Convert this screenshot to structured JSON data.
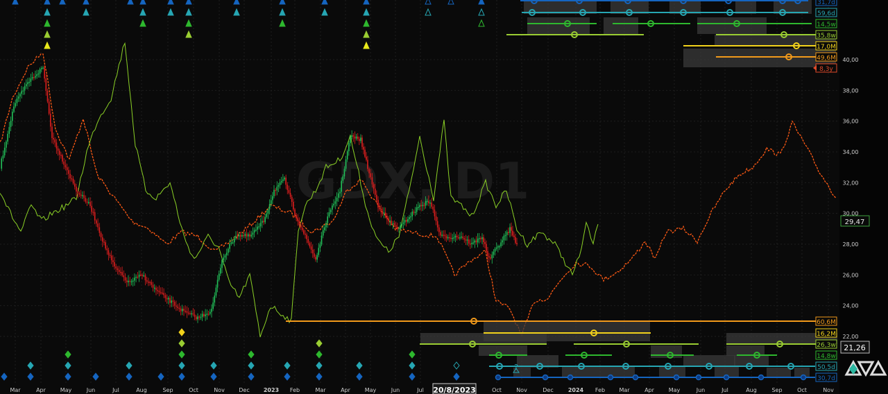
{
  "chart_data": {
    "type": "line",
    "title": "GDX, D1",
    "series": [
      {
        "name": "GDX",
        "kind": "candles"
      },
      {
        "name": "",
        "kind": "green-line"
      },
      {
        "name": "",
        "kind": "orange-dashed"
      }
    ],
    "ylim": [
      20.0,
      42.0
    ],
    "yticks": [
      "40,00",
      "38,00",
      "36,00",
      "34,00",
      "32,00",
      "30,00",
      "28,00",
      "26,00",
      "24,00",
      "22,00"
    ],
    "xticks": [
      "Mar",
      "Apr",
      "May",
      "Jun",
      "Jul",
      "Aug",
      "Sep",
      "Oct",
      "Nov",
      "Dec",
      "2023",
      "Feb",
      "Mar",
      "Apr",
      "May",
      "Jun",
      "Jul",
      "20/8/2023",
      "Oct",
      "Nov",
      "Dec",
      "2024",
      "Feb",
      "Mar",
      "Apr",
      "May",
      "Jun",
      "Jul",
      "Aug",
      "Sep",
      "Oct",
      "Nov"
    ],
    "cursor_date": "20/8/2023",
    "last_price": "29,47",
    "crosshair_price": "21,26",
    "top_cycles": [
      {
        "label": "31,7d",
        "color": "#1565c0"
      },
      {
        "label": "59,6d",
        "color": "#26a6b3"
      },
      {
        "label": "14,5w",
        "color": "#2eb82e"
      },
      {
        "label": "35,8w",
        "color": "#9acd32"
      },
      {
        "label": "17,0M",
        "color": "#f2d21b"
      },
      {
        "label": "49,6M",
        "color": "#f29a1b"
      },
      {
        "label": "8,3y",
        "color": "#e04a2a"
      }
    ],
    "bottom_cycles": [
      {
        "label": "60,6M",
        "color": "#f29a1b"
      },
      {
        "label": "16,2M",
        "color": "#f2d21b"
      },
      {
        "label": "26,3w",
        "color": "#9acd32"
      },
      {
        "label": "14,8w",
        "color": "#2eb82e"
      },
      {
        "label": "50,5d",
        "color": "#26a6b3"
      },
      {
        "label": "30,7d",
        "color": "#1565c0"
      }
    ],
    "bottom_marker": "?"
  }
}
